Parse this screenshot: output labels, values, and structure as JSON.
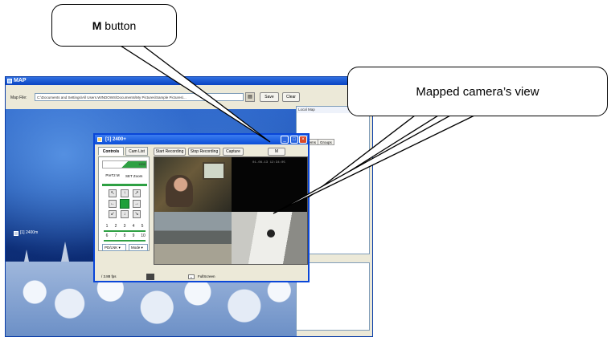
{
  "callouts": {
    "m_button_bold": "M",
    "m_button_rest": " button",
    "mapped_view": "Mapped camera’s view"
  },
  "app": {
    "title": "MAP",
    "map_file_label": "Map File:",
    "map_file_value": "C:\\Documents and Settings\\All Users.WINDOWS\\Documents\\My Pictures\\Sample Pictures\\...",
    "save_label": "Save",
    "clear_label": "Clear",
    "camera_marker_label": "[1] 2400m",
    "right_panel_title": "Local Map",
    "right_tabs": [
      "Items",
      "Groups"
    ]
  },
  "camera_window": {
    "title": "[1] 2400+",
    "tabs": [
      "Controls",
      "Cam List"
    ],
    "buttons": [
      "Start Recording",
      "Stop Recording",
      "Capture",
      "M"
    ],
    "slider_value": "1000",
    "ptz_label": "PreT2 M",
    "set_zoom_label": "SET Zoom",
    "presets": [
      "1",
      "2",
      "3",
      "4",
      "5",
      "6",
      "7",
      "8",
      "9",
      "10"
    ],
    "ptz_select": "PD/LNK",
    "mode_select": "Mode",
    "video_timestamp": "01-08-13 12:34:05",
    "fps_label": "/ 3.88 fps",
    "fullscreen_label": "FullScreen"
  }
}
